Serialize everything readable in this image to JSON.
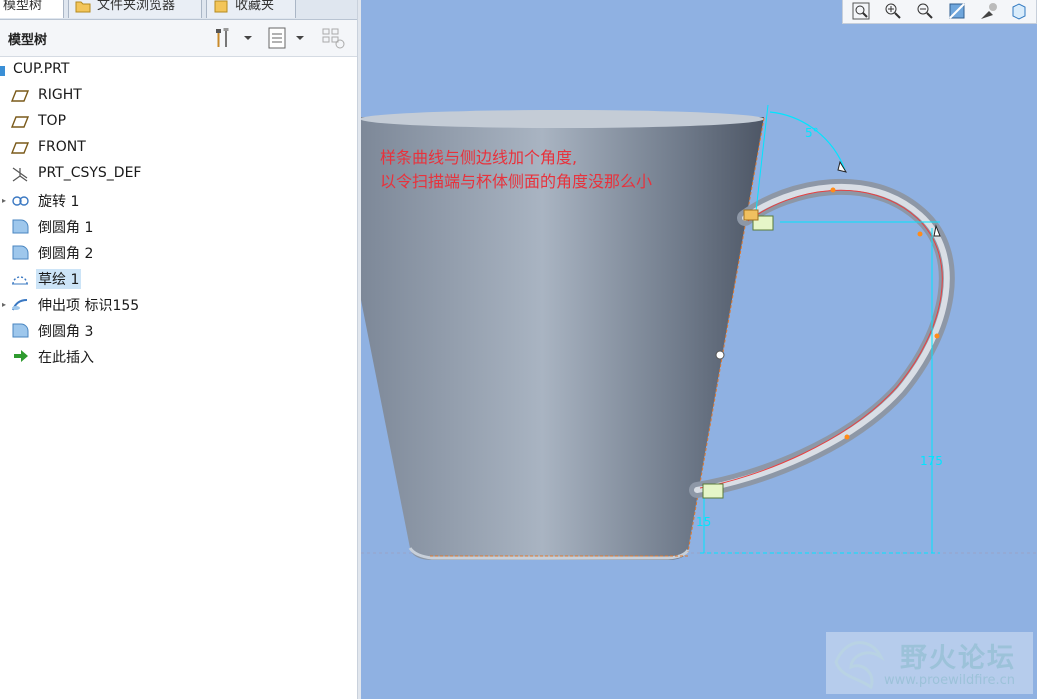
{
  "tabs": [
    {
      "label": "模型树"
    },
    {
      "label": "文件夹浏览器"
    },
    {
      "label": "收藏夹"
    }
  ],
  "panel": {
    "title": "模型树"
  },
  "tree": [
    {
      "label": "CUP.PRT",
      "icon": "part-icon",
      "expandable": false,
      "selected": false
    },
    {
      "label": "RIGHT",
      "icon": "datum-plane-icon",
      "expandable": false,
      "selected": false
    },
    {
      "label": "TOP",
      "icon": "datum-plane-icon",
      "expandable": false,
      "selected": false
    },
    {
      "label": "FRONT",
      "icon": "datum-plane-icon",
      "expandable": false,
      "selected": false
    },
    {
      "label": "PRT_CSYS_DEF",
      "icon": "csys-icon",
      "expandable": false,
      "selected": false
    },
    {
      "label": "旋转 1",
      "icon": "revolve-icon",
      "expandable": true,
      "selected": false
    },
    {
      "label": "倒圆角 1",
      "icon": "round-icon",
      "expandable": false,
      "selected": false
    },
    {
      "label": "倒圆角 2",
      "icon": "round-icon",
      "expandable": false,
      "selected": false
    },
    {
      "label": "草绘 1",
      "icon": "sketch-icon",
      "expandable": false,
      "selected": true
    },
    {
      "label": "伸出项 标识155",
      "icon": "sweep-icon",
      "expandable": true,
      "selected": false
    },
    {
      "label": "倒圆角 3",
      "icon": "round-icon",
      "expandable": false,
      "selected": false
    },
    {
      "label": "在此插入",
      "icon": "insert-arrow-icon",
      "expandable": false,
      "selected": false
    }
  ],
  "annotation": {
    "line1": "样条曲线与侧边线加个角度,",
    "line2": "以令扫描端与杯体侧面的角度没那么小"
  },
  "dimensions": {
    "angle": "5°",
    "height": "175",
    "offset": "15"
  },
  "watermark": {
    "text": "野火论坛",
    "url": "www.proewildfire.cn"
  },
  "colors": {
    "viewport_bg": "#8fb1e2",
    "annotation": "#e8323c",
    "dimension": "#00e5ff",
    "selection": "#cce4f7"
  }
}
